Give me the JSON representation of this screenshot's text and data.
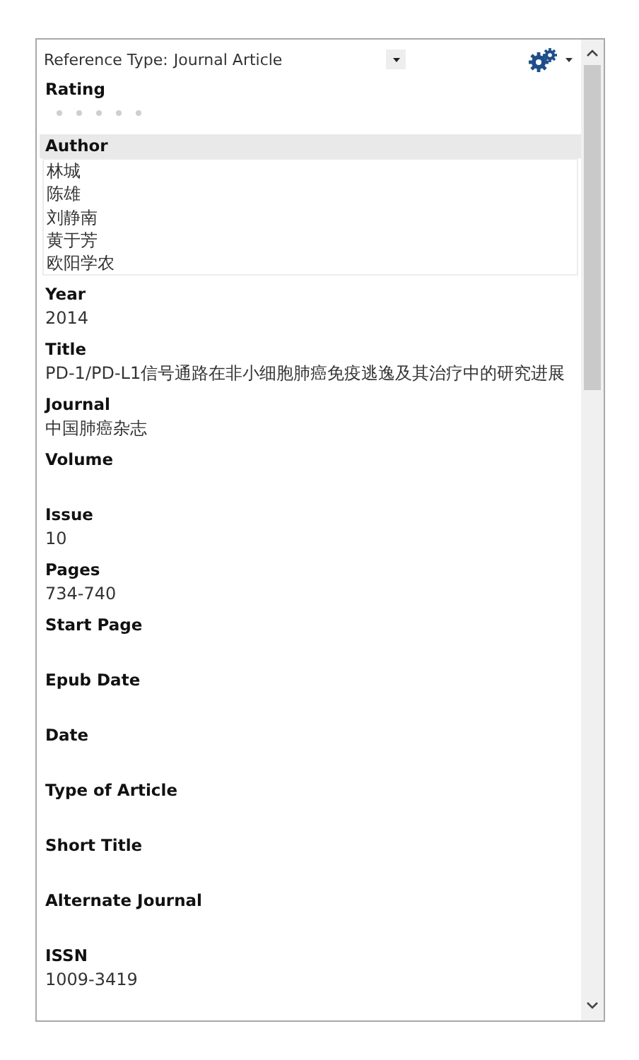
{
  "reference_type": {
    "label": "Reference Type:",
    "value": "Journal Article"
  },
  "rating": {
    "label": "Rating",
    "stars": 0
  },
  "fields": [
    {
      "kind": "list",
      "label": "Author",
      "selected": true,
      "values": [
        "林城",
        "陈雄",
        "刘静南",
        "黄于芳",
        "欧阳学农"
      ]
    },
    {
      "kind": "text",
      "label": "Year",
      "selected": false,
      "value": "2014"
    },
    {
      "kind": "text",
      "label": "Title",
      "selected": false,
      "value": "PD-1/PD-L1信号通路在非小细胞肺癌免疫逃逸及其治疗中的研究进展"
    },
    {
      "kind": "text",
      "label": "Journal",
      "selected": false,
      "value": "中国肺癌杂志"
    },
    {
      "kind": "text",
      "label": "Volume",
      "selected": false
    },
    {
      "kind": "text",
      "label": "Issue",
      "selected": false,
      "value": "10"
    },
    {
      "kind": "text",
      "label": "Pages",
      "selected": false,
      "value": "734-740"
    },
    {
      "kind": "text",
      "label": "Start Page",
      "selected": false
    },
    {
      "kind": "text",
      "label": "Epub Date",
      "selected": false
    },
    {
      "kind": "text",
      "label": "Date",
      "selected": false
    },
    {
      "kind": "text",
      "label": "Type of Article",
      "selected": false
    },
    {
      "kind": "text",
      "label": "Short Title",
      "selected": false
    },
    {
      "kind": "text",
      "label": "Alternate Journal",
      "selected": false
    },
    {
      "kind": "text",
      "label": "ISSN",
      "selected": false,
      "value": "1009-3419"
    }
  ]
}
